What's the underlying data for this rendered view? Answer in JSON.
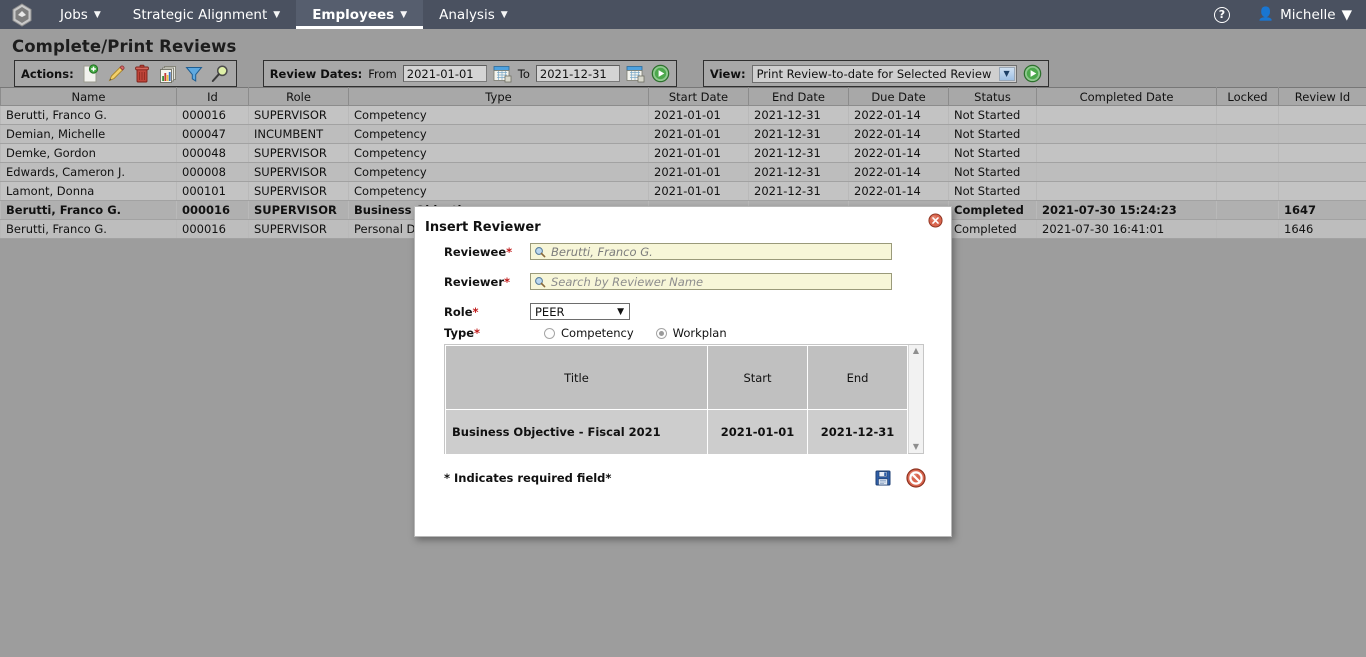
{
  "topnav": {
    "logo_icon": "hexagon-logo",
    "items": [
      {
        "label": "Jobs",
        "active": false
      },
      {
        "label": "Strategic Alignment",
        "active": false
      },
      {
        "label": "Employees",
        "active": true
      },
      {
        "label": "Analysis",
        "active": false
      }
    ],
    "help_label": "?",
    "user_name": "Michelle"
  },
  "page": {
    "title": "Complete/Print Reviews"
  },
  "toolbar": {
    "actions_label": "Actions:",
    "action_icons": [
      "new-document-icon",
      "edit-pencil-icon",
      "delete-trash-icon",
      "reports-icon",
      "filter-funnel-icon",
      "search-magnifier-icon"
    ],
    "review_dates_label": "Review Dates:",
    "from_label": "From",
    "from_value": "2021-01-01",
    "to_label": "To",
    "to_value": "2021-12-31",
    "calendar_icon": "calendar-icon",
    "go_icon": "go-play-icon",
    "view_label": "View:",
    "view_value": "Print Review-to-date for Selected Review"
  },
  "grid": {
    "columns": [
      "Name",
      "Id",
      "Role",
      "Type",
      "Start Date",
      "End Date",
      "Due Date",
      "Status",
      "Completed Date",
      "Locked",
      "Review Id"
    ],
    "rows": [
      {
        "name": "Berutti, Franco G.",
        "id": "000016",
        "role": "SUPERVISOR",
        "type": "Competency",
        "start": "2021-01-01",
        "end": "2021-12-31",
        "due": "2022-01-14",
        "status": "Not Started",
        "completed": "",
        "locked": "",
        "review_id": ""
      },
      {
        "name": "Demian, Michelle",
        "id": "000047",
        "role": "INCUMBENT",
        "type": "Competency",
        "start": "2021-01-01",
        "end": "2021-12-31",
        "due": "2022-01-14",
        "status": "Not Started",
        "completed": "",
        "locked": "",
        "review_id": ""
      },
      {
        "name": "Demke, Gordon",
        "id": "000048",
        "role": "SUPERVISOR",
        "type": "Competency",
        "start": "2021-01-01",
        "end": "2021-12-31",
        "due": "2022-01-14",
        "status": "Not Started",
        "completed": "",
        "locked": "",
        "review_id": ""
      },
      {
        "name": "Edwards, Cameron J.",
        "id": "000008",
        "role": "SUPERVISOR",
        "type": "Competency",
        "start": "2021-01-01",
        "end": "2021-12-31",
        "due": "2022-01-14",
        "status": "Not Started",
        "completed": "",
        "locked": "",
        "review_id": ""
      },
      {
        "name": "Lamont, Donna",
        "id": "000101",
        "role": "SUPERVISOR",
        "type": "Competency",
        "start": "2021-01-01",
        "end": "2021-12-31",
        "due": "2022-01-14",
        "status": "Not Started",
        "completed": "",
        "locked": "",
        "review_id": ""
      },
      {
        "name": "Berutti, Franco G.",
        "id": "000016",
        "role": "SUPERVISOR",
        "type": "Business Objective",
        "start": "",
        "end": "",
        "due": "",
        "status": "Completed",
        "completed": "2021-07-30 15:24:23",
        "locked": "",
        "review_id": "1647"
      },
      {
        "name": "Berutti, Franco G.",
        "id": "000016",
        "role": "SUPERVISOR",
        "type": "Personal Development",
        "start": "",
        "end": "",
        "due": "",
        "status": "Completed",
        "completed": "2021-07-30 16:41:01",
        "locked": "",
        "review_id": "1646"
      }
    ]
  },
  "modal": {
    "title": "Insert Reviewer",
    "close_icon": "close-icon",
    "reviewee_label": "Reviewee",
    "reviewee_value": "Berutti, Franco G.",
    "reviewer_label": "Reviewer",
    "reviewer_placeholder": "Search by Reviewer Name",
    "search_icon": "search-magnifier-icon",
    "role_label": "Role",
    "role_value": "PEER",
    "type_label": "Type",
    "type_options": [
      {
        "label": "Competency",
        "selected": false
      },
      {
        "label": "Workplan",
        "selected": true
      }
    ],
    "inner_table": {
      "columns": [
        "Title",
        "Start",
        "End"
      ],
      "rows": [
        {
          "title": "Business Objective - Fiscal 2021",
          "start": "2021-01-01",
          "end": "2021-12-31"
        }
      ]
    },
    "required_note": "* Indicates required field*",
    "save_icon": "save-floppy-icon",
    "cancel_icon": "cancel-forbidden-icon"
  },
  "colors": {
    "nav_bg": "#4a5160",
    "page_bg": "#9d9d9d",
    "grid_row": "#c3c3c3",
    "grid_header": "#a8a8a8",
    "field_yellow": "#f7f6d8",
    "required_red": "#c01b1b",
    "go_green": "#2f8f2f"
  }
}
